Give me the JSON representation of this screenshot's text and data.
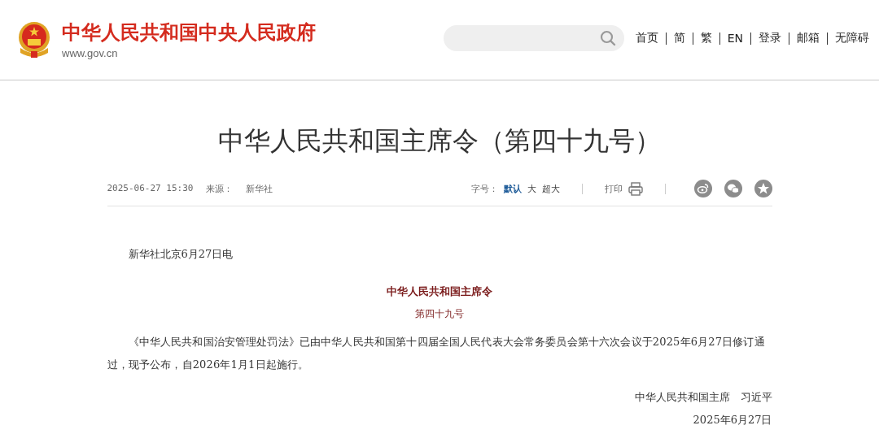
{
  "header": {
    "site_name": "中华人民共和国中央人民政府",
    "domain": "www.gov.cn",
    "nav": [
      {
        "label": "首页"
      },
      {
        "label": "简"
      },
      {
        "label": "繁"
      },
      {
        "label": "EN"
      },
      {
        "label": "登录"
      },
      {
        "label": "邮箱"
      },
      {
        "label": "无障碍"
      }
    ]
  },
  "article": {
    "title": "中华人民共和国主席令（第四十九号）",
    "meta": {
      "datetime": "2025-06-27 15:30",
      "source_label": "来源：",
      "source": "新华社",
      "font_size": {
        "label": "字号：",
        "options": [
          {
            "label": "默认",
            "selected": true
          },
          {
            "label": "大",
            "selected": false
          },
          {
            "label": "超大",
            "selected": false
          }
        ]
      },
      "print": "打印"
    },
    "body": [
      {
        "kind": "dateline",
        "text": "新华社北京6月27日电"
      },
      {
        "kind": "heading",
        "text": "中华人民共和国主席令"
      },
      {
        "kind": "subheading",
        "text": "第四十九号"
      },
      {
        "kind": "paragraph",
        "text": "《中华人民共和国治安管理处罚法》已由中华人民共和国第十四届全国人民代表大会常务委员会第十六次会议于2025年6月27日修订通过，现予公布，自2026年1月1日起施行。"
      },
      {
        "kind": "signature",
        "text": "中华人民共和国主席　习近平"
      },
      {
        "kind": "signature",
        "text": "2025年6月27日"
      }
    ]
  }
}
